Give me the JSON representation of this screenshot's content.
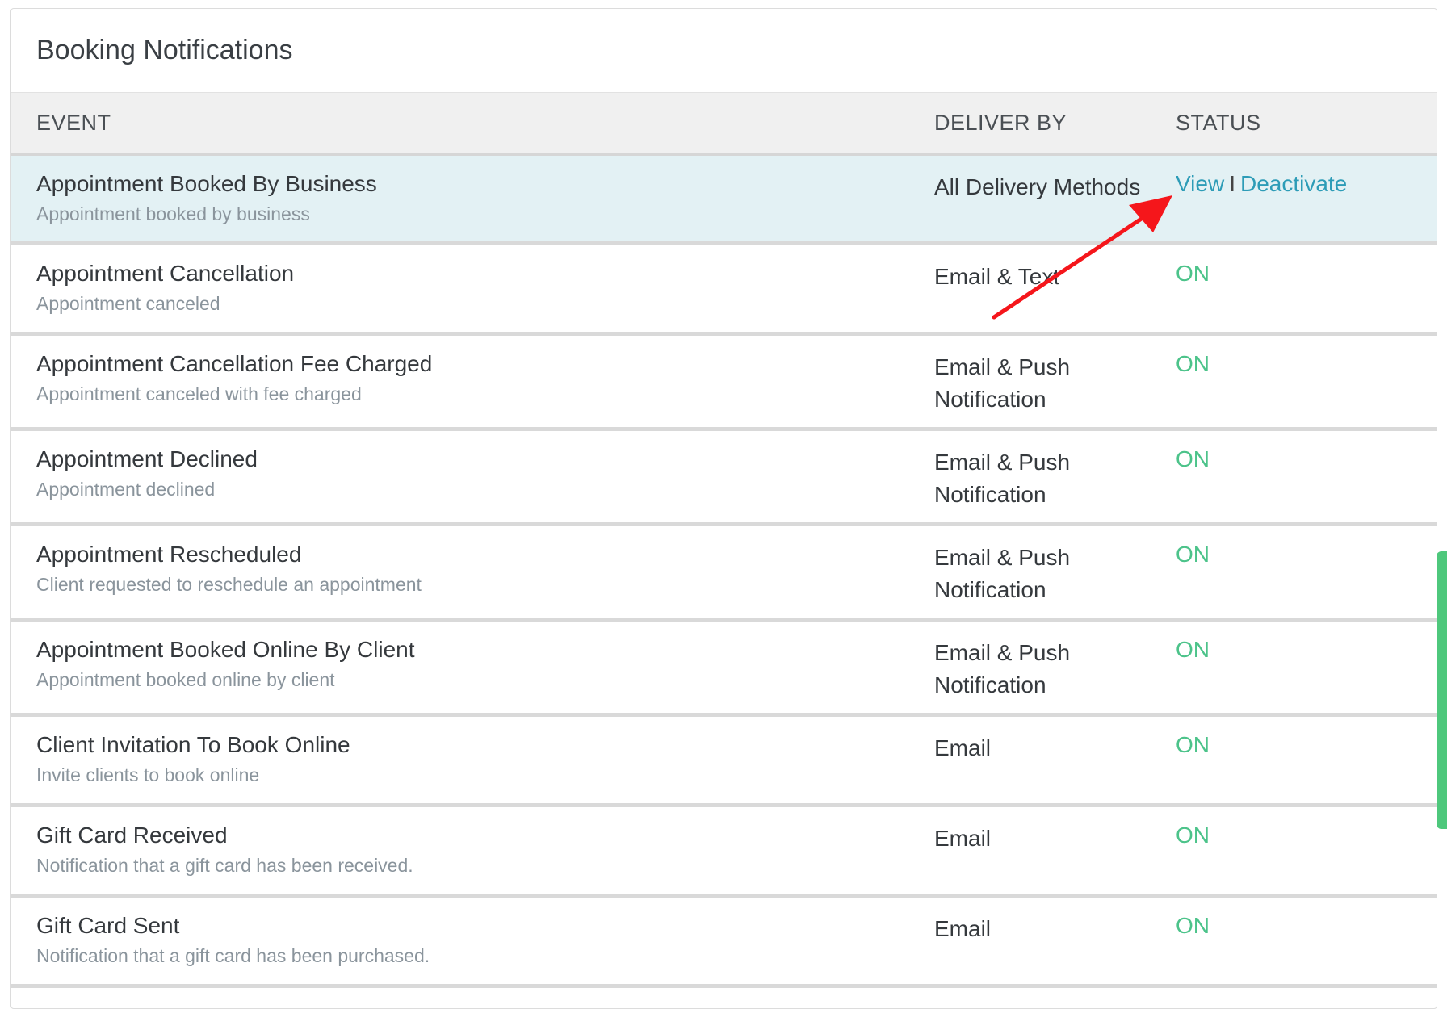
{
  "panel": {
    "title": "Booking Notifications"
  },
  "table": {
    "headers": {
      "event": "EVENT",
      "deliver_by": "DELIVER BY",
      "status": "STATUS"
    },
    "rows": [
      {
        "title": "Appointment Booked By Business",
        "subtitle": "Appointment booked by business",
        "deliver": "All Delivery Methods",
        "status": "",
        "view_label": "View",
        "separator": "I",
        "deactivate_label": "Deactivate",
        "highlighted": true
      },
      {
        "title": "Appointment Cancellation",
        "subtitle": "Appointment canceled",
        "deliver": "Email & Text",
        "status": "ON"
      },
      {
        "title": "Appointment Cancellation Fee Charged",
        "subtitle": "Appointment canceled with fee charged",
        "deliver": "Email & Push Notification",
        "status": "ON"
      },
      {
        "title": "Appointment Declined",
        "subtitle": "Appointment declined",
        "deliver": "Email & Push Notification",
        "status": "ON"
      },
      {
        "title": "Appointment Rescheduled",
        "subtitle": "Client requested to reschedule an appointment",
        "deliver": "Email & Push Notification",
        "status": "ON"
      },
      {
        "title": "Appointment Booked Online By Client",
        "subtitle": "Appointment booked online by client",
        "deliver": "Email & Push Notification",
        "status": "ON"
      },
      {
        "title": "Client Invitation To Book Online",
        "subtitle": "Invite clients to book online",
        "deliver": "Email",
        "status": "ON"
      },
      {
        "title": "Gift Card Received",
        "subtitle": "Notification that a gift card has been received.",
        "deliver": "Email",
        "status": "ON"
      },
      {
        "title": "Gift Card Sent",
        "subtitle": "Notification that a gift card has been purchased.",
        "deliver": "Email",
        "status": "ON"
      }
    ]
  },
  "colors": {
    "status_on": "#4cc38a",
    "link": "#2d9cb7",
    "highlight_row": "#e3f1f4",
    "annotation_arrow": "#f5161b",
    "scrollbar": "#4ec87c"
  },
  "icons": {
    "annotation": "red-arrow-icon"
  }
}
